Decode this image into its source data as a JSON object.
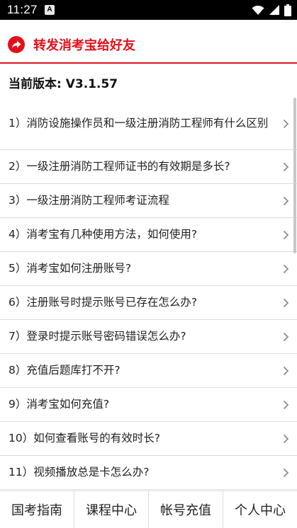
{
  "status_bar": {
    "time": "11:27",
    "notification_badge": "A",
    "icons": [
      "wifi-icon",
      "signal-icon",
      "battery-icon"
    ]
  },
  "share": {
    "label": "转发消考宝给好友",
    "icon": "share-arrow-icon",
    "color": "#e3101c"
  },
  "version": {
    "text": "当前版本: V3.1.57"
  },
  "faq": [
    {
      "label": "1）消防设施操作员和一级注册消防工程师有什么区别"
    },
    {
      "label": "2）一级注册消防工程师证书的有效期是多长?"
    },
    {
      "label": "3）一级注册消防工程师考证流程"
    },
    {
      "label": "4）消考宝有几种使用方法，如何使用?"
    },
    {
      "label": "5）消考宝如何注册账号?"
    },
    {
      "label": "6）注册账号时提示账号已存在怎么办?"
    },
    {
      "label": "7）登录时提示账号密码错误怎么办?"
    },
    {
      "label": "8）充值后题库打不开?"
    },
    {
      "label": "9）消考宝如何充值?"
    },
    {
      "label": "10）如何查看账号的有效时长?"
    },
    {
      "label": "11）视频播放总是卡怎么办?"
    }
  ],
  "tabs": [
    {
      "label": "国考指南"
    },
    {
      "label": "课程中心"
    },
    {
      "label": "帐号充值"
    },
    {
      "label": "个人中心"
    }
  ]
}
